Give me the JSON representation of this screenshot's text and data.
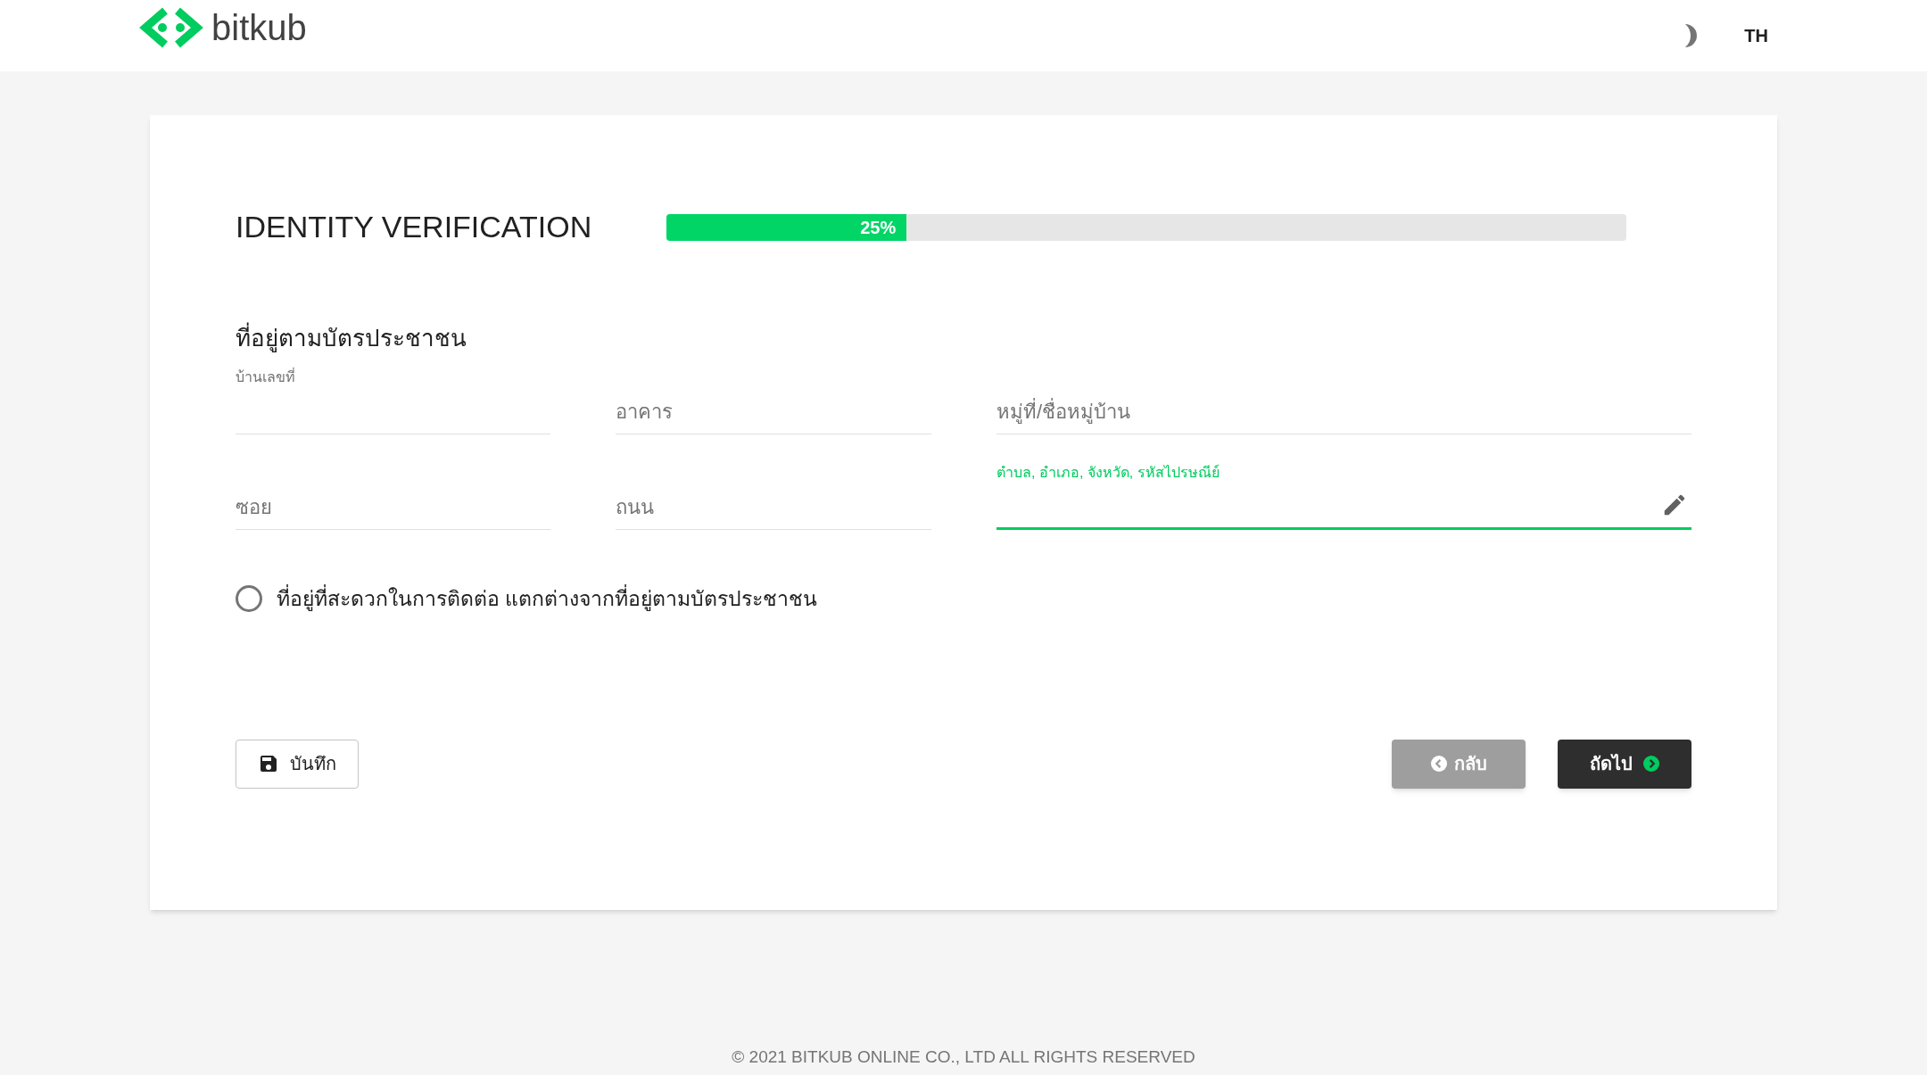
{
  "header": {
    "logo_text": "bitkub",
    "language": "TH"
  },
  "form": {
    "title": "IDENTITY VERIFICATION",
    "progress": {
      "level": 0.25,
      "reading": "25%"
    },
    "section_title": "ที่อยู่ตามบัตรประชาชน",
    "fields": [
      {
        "label": "บ้านเลขที่",
        "floated": true,
        "focused": false
      },
      {
        "label": "อาคาร",
        "floated": false,
        "focused": false
      },
      {
        "label": "หมู่ที่/ชื่อหมู่บ้าน",
        "floated": false,
        "focused": false
      },
      {
        "label": "ซอย",
        "floated": false,
        "focused": false
      },
      {
        "label": "ถนน",
        "floated": false,
        "focused": false
      },
      {
        "label": "ตำบล, อำเภอ, จังหวัด, รหัสไปรษณีย์",
        "floated": true,
        "focused": true,
        "editable": true
      }
    ],
    "option": {
      "label": "ที่อยู่ที่สะดวกในการติดต่อ แตกต่างจากที่อยู่ตามบัตรประชาชน",
      "selected": false
    },
    "buttons": [
      {
        "kind": "save",
        "label": "บันทึก"
      },
      {
        "kind": "back",
        "label": "กลับ"
      },
      {
        "kind": "next",
        "label": "ถัดไป"
      }
    ]
  },
  "footer": "© 2021 BITKUB ONLINE CO., LTD ALL RIGHTS RESERVED"
}
